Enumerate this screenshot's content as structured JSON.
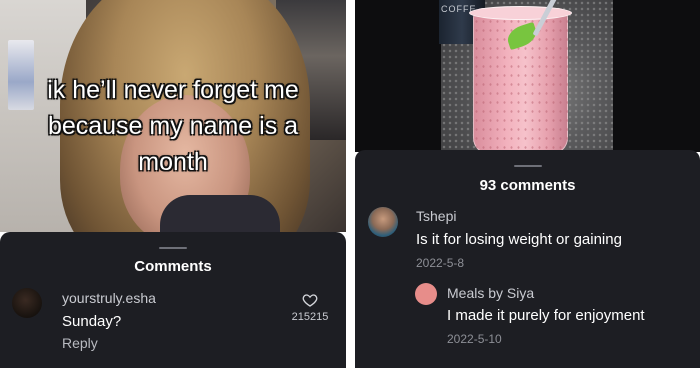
{
  "left_post": {
    "caption_lines": [
      "ik he’ll never forget me",
      "because my name is a",
      "month"
    ],
    "comments_header": "Comments",
    "comment": {
      "username": "yourstruly.esha",
      "text": "Sunday?",
      "reply_label": "Reply",
      "like_count": "215215",
      "like_icon": "heart-outline-icon"
    }
  },
  "right_post": {
    "image_label": "COFFE",
    "comments_header": "93 comments",
    "comments": [
      {
        "username": "Tshepi",
        "text": "Is it for losing weight or gaining",
        "date": "2022-5-8"
      },
      {
        "username": "Meals by Siya",
        "text": "I made it purely for enjoyment",
        "date": "2022-5-10",
        "is_reply": true
      }
    ]
  },
  "colors": {
    "sheet_background": "#1d1e23",
    "primary_text": "#ffffff",
    "secondary_text": "#8d8f96",
    "reply_avatar": "#e78d8a"
  }
}
